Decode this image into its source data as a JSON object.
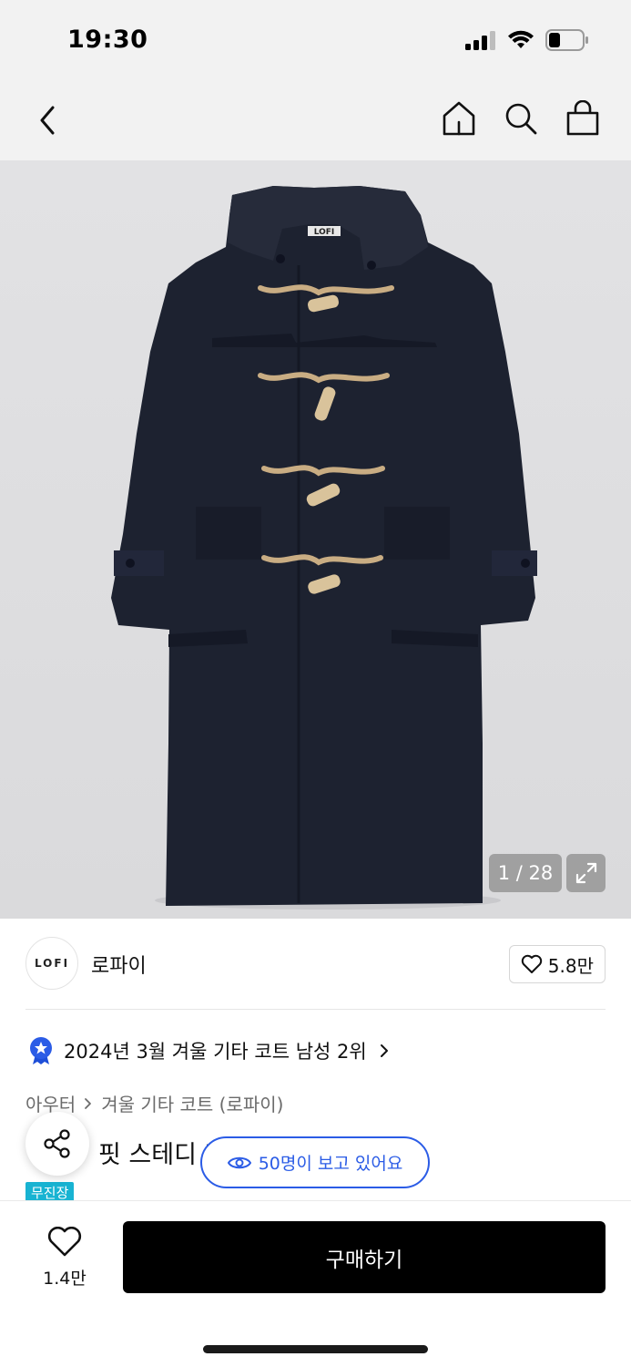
{
  "status_bar": {
    "time": "19:30"
  },
  "nav": {
    "back_icon": "chevron-left-icon",
    "icons": [
      "home-icon",
      "search-icon",
      "shopping-bag-icon"
    ]
  },
  "product_image": {
    "label_on_coat": "LOFI",
    "counter": "1 / 28",
    "expand_icon": "expand-icon"
  },
  "brand": {
    "logo_text": "LOFI",
    "name": "로파이",
    "like_count": "5.8만"
  },
  "ranking": {
    "text": "2024년 3월 겨울 기타 코트 남성 2위",
    "badge_color": "#2b5ce6"
  },
  "breadcrumb": {
    "category": "아우터",
    "subcategory": "겨울 기타 코트 (로파이)"
  },
  "product": {
    "title_visible": "핏 스테디 더",
    "tag": "무진장",
    "tag_color": "#18b3d2"
  },
  "viewers": {
    "text": "50명이 보고 있어요"
  },
  "bottom_bar": {
    "wish_count": "1.4만",
    "buy_label": "구매하기"
  },
  "colors": {
    "accent": "#2b5ce6",
    "buy_button": "#000000"
  }
}
